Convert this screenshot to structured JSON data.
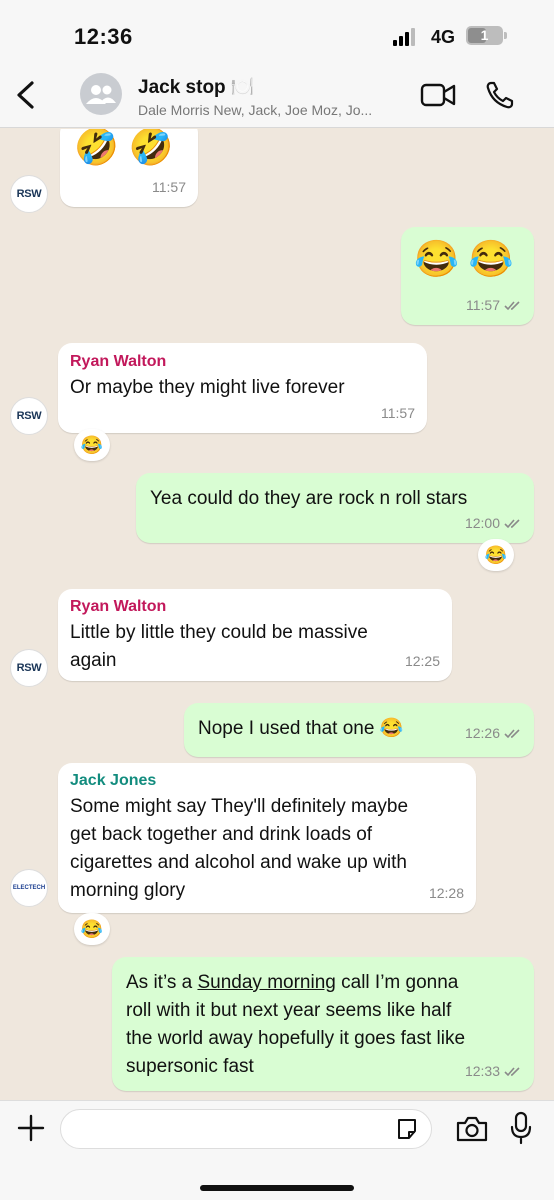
{
  "status_bar": {
    "time": "12:36",
    "network": "4G",
    "battery": "1"
  },
  "header": {
    "title": "Jack stop 🍽️",
    "subtitle": "Dale Morris New, Jack, Joe Moz, Jo...",
    "icons": [
      "back-chevron-icon",
      "group-avatar-icon",
      "video-call-icon",
      "voice-call-icon"
    ]
  },
  "colors": {
    "incoming": "#ffffff",
    "outgoing": "#d9fdd3",
    "ryan": "#c2185b",
    "jack": "#128c7e",
    "background": "#efe7dd"
  },
  "messages": [
    {
      "from": "them",
      "avatar": "RSW",
      "text": "🤣 🤣",
      "time": "11:57"
    },
    {
      "from": "me",
      "text": "😂 😂",
      "time": "11:57"
    },
    {
      "from": "them",
      "sender": "Ryan Walton",
      "avatar": "RSW",
      "text": "Or maybe they might live forever",
      "time": "11:57",
      "reaction": "😂"
    },
    {
      "from": "me",
      "text": "Yea could do they are rock n roll stars",
      "time": "12:00",
      "reaction": "😂"
    },
    {
      "from": "them",
      "sender": "Ryan Walton",
      "avatar": "RSW",
      "text_lines": [
        "Little by little they could be massive",
        "again"
      ],
      "time": "12:25"
    },
    {
      "from": "me",
      "text": "Nope I used that one 😂",
      "time": "12:26"
    },
    {
      "from": "them",
      "sender": "Jack Jones",
      "avatar": "ELECTECH",
      "text_lines": [
        "Some might say They'll definitely maybe",
        "get back together and drink loads of",
        "cigarettes and alcohol and wake up with",
        "morning glory"
      ],
      "time": "12:28",
      "reaction": "😂"
    },
    {
      "from": "me",
      "text_parts": {
        "before": "As it’s a ",
        "link": "Sunday morning",
        "after": " call I’m gonna"
      },
      "text_lines": [
        "roll with it but next year seems like half",
        "the world away hopefully it goes fast like",
        "supersonic fast"
      ],
      "time": "12:33"
    }
  ]
}
